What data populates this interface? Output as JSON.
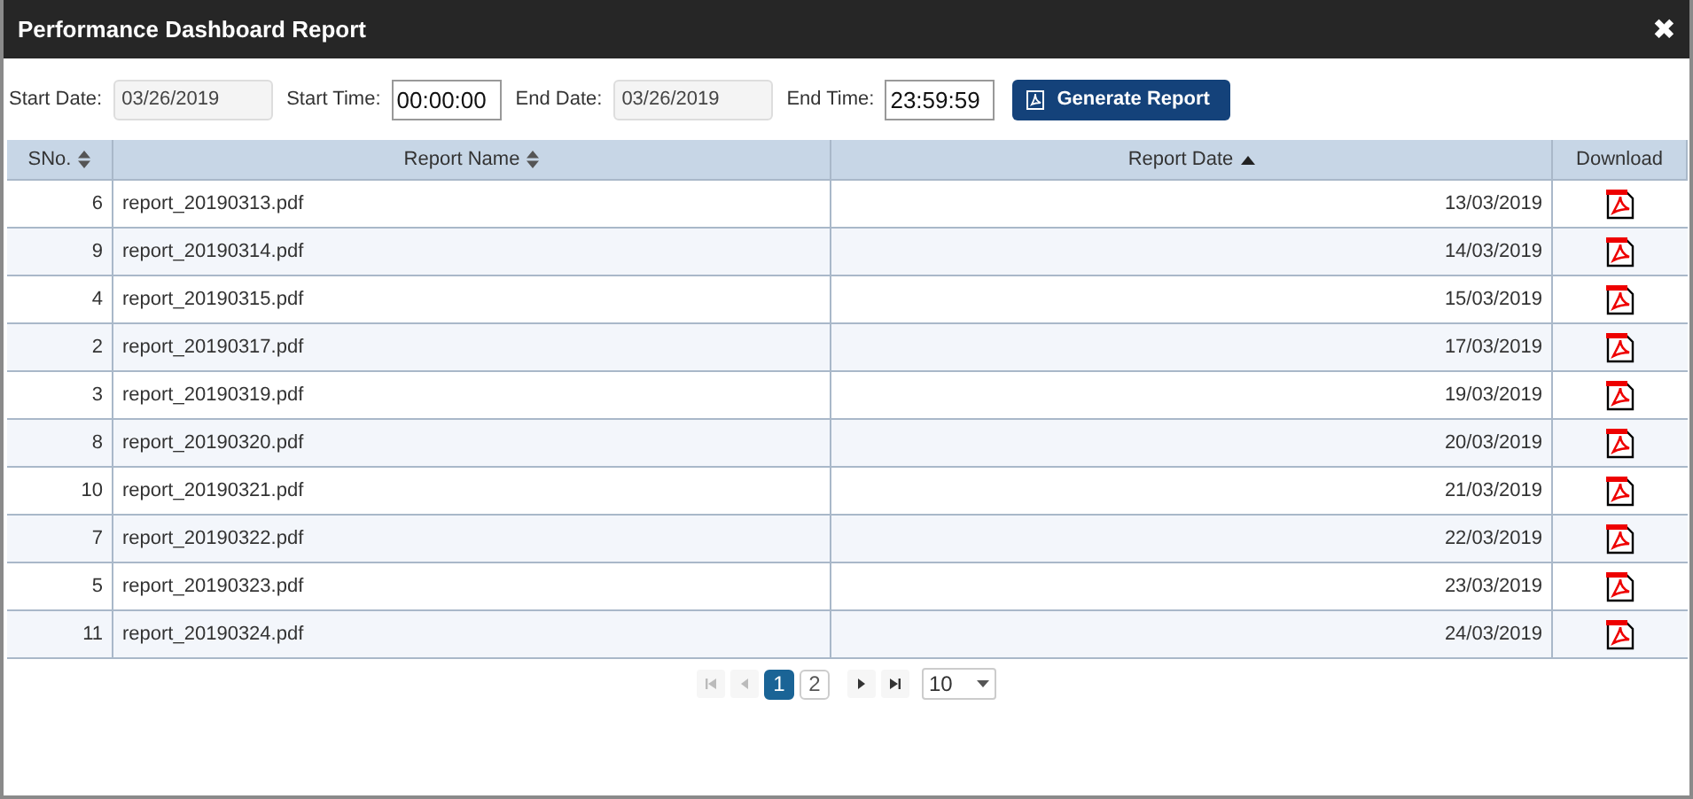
{
  "window": {
    "title": "Performance Dashboard Report",
    "close": "✖"
  },
  "filters": [
    {
      "label": "Start Date:",
      "value": "03/26/2019",
      "kind": "date"
    },
    {
      "label": "Start Time:",
      "value": "00:00:00",
      "kind": "time"
    },
    {
      "label": "End Date:",
      "value": "03/26/2019",
      "kind": "date"
    },
    {
      "label": "End Time:",
      "value": "23:59:59",
      "kind": "time"
    }
  ],
  "generate_button": "Generate Report",
  "table": {
    "columns": [
      {
        "label": "SNo.",
        "sortable": true,
        "sorted_ascending": false
      },
      {
        "label": "Report Name",
        "sortable": true,
        "sorted_ascending": false
      },
      {
        "label": "Report Date",
        "sortable": true,
        "sorted_ascending": true
      },
      {
        "label": "Download",
        "sortable": false
      }
    ],
    "rows": [
      {
        "sno": "6",
        "name": "report_20190313.pdf",
        "date": "13/03/2019"
      },
      {
        "sno": "9",
        "name": "report_20190314.pdf",
        "date": "14/03/2019"
      },
      {
        "sno": "4",
        "name": "report_20190315.pdf",
        "date": "15/03/2019"
      },
      {
        "sno": "2",
        "name": "report_20190317.pdf",
        "date": "17/03/2019"
      },
      {
        "sno": "3",
        "name": "report_20190319.pdf",
        "date": "19/03/2019"
      },
      {
        "sno": "8",
        "name": "report_20190320.pdf",
        "date": "20/03/2019"
      },
      {
        "sno": "10",
        "name": "report_20190321.pdf",
        "date": "21/03/2019"
      },
      {
        "sno": "7",
        "name": "report_20190322.pdf",
        "date": "22/03/2019"
      },
      {
        "sno": "5",
        "name": "report_20190323.pdf",
        "date": "23/03/2019"
      },
      {
        "sno": "11",
        "name": "report_20190324.pdf",
        "date": "24/03/2019"
      }
    ]
  },
  "pagination": {
    "pages": [
      {
        "label": "1",
        "selected": true
      },
      {
        "label": "2",
        "selected": false
      }
    ],
    "page_size": "10"
  }
}
